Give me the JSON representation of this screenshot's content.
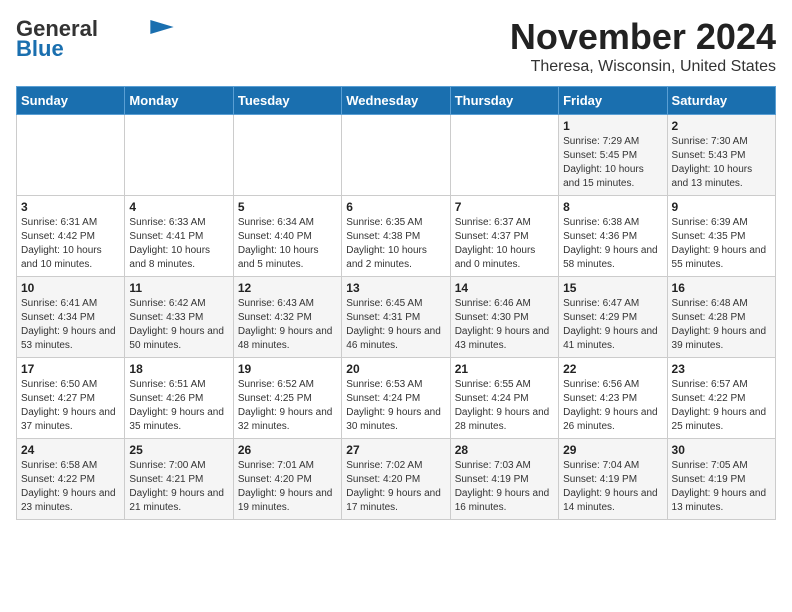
{
  "logo": {
    "line1": "General",
    "line2": "Blue"
  },
  "title": "November 2024",
  "subtitle": "Theresa, Wisconsin, United States",
  "weekdays": [
    "Sunday",
    "Monday",
    "Tuesday",
    "Wednesday",
    "Thursday",
    "Friday",
    "Saturday"
  ],
  "weeks": [
    [
      {
        "day": "",
        "info": ""
      },
      {
        "day": "",
        "info": ""
      },
      {
        "day": "",
        "info": ""
      },
      {
        "day": "",
        "info": ""
      },
      {
        "day": "",
        "info": ""
      },
      {
        "day": "1",
        "info": "Sunrise: 7:29 AM\nSunset: 5:45 PM\nDaylight: 10 hours and 15 minutes."
      },
      {
        "day": "2",
        "info": "Sunrise: 7:30 AM\nSunset: 5:43 PM\nDaylight: 10 hours and 13 minutes."
      }
    ],
    [
      {
        "day": "3",
        "info": "Sunrise: 6:31 AM\nSunset: 4:42 PM\nDaylight: 10 hours and 10 minutes."
      },
      {
        "day": "4",
        "info": "Sunrise: 6:33 AM\nSunset: 4:41 PM\nDaylight: 10 hours and 8 minutes."
      },
      {
        "day": "5",
        "info": "Sunrise: 6:34 AM\nSunset: 4:40 PM\nDaylight: 10 hours and 5 minutes."
      },
      {
        "day": "6",
        "info": "Sunrise: 6:35 AM\nSunset: 4:38 PM\nDaylight: 10 hours and 2 minutes."
      },
      {
        "day": "7",
        "info": "Sunrise: 6:37 AM\nSunset: 4:37 PM\nDaylight: 10 hours and 0 minutes."
      },
      {
        "day": "8",
        "info": "Sunrise: 6:38 AM\nSunset: 4:36 PM\nDaylight: 9 hours and 58 minutes."
      },
      {
        "day": "9",
        "info": "Sunrise: 6:39 AM\nSunset: 4:35 PM\nDaylight: 9 hours and 55 minutes."
      }
    ],
    [
      {
        "day": "10",
        "info": "Sunrise: 6:41 AM\nSunset: 4:34 PM\nDaylight: 9 hours and 53 minutes."
      },
      {
        "day": "11",
        "info": "Sunrise: 6:42 AM\nSunset: 4:33 PM\nDaylight: 9 hours and 50 minutes."
      },
      {
        "day": "12",
        "info": "Sunrise: 6:43 AM\nSunset: 4:32 PM\nDaylight: 9 hours and 48 minutes."
      },
      {
        "day": "13",
        "info": "Sunrise: 6:45 AM\nSunset: 4:31 PM\nDaylight: 9 hours and 46 minutes."
      },
      {
        "day": "14",
        "info": "Sunrise: 6:46 AM\nSunset: 4:30 PM\nDaylight: 9 hours and 43 minutes."
      },
      {
        "day": "15",
        "info": "Sunrise: 6:47 AM\nSunset: 4:29 PM\nDaylight: 9 hours and 41 minutes."
      },
      {
        "day": "16",
        "info": "Sunrise: 6:48 AM\nSunset: 4:28 PM\nDaylight: 9 hours and 39 minutes."
      }
    ],
    [
      {
        "day": "17",
        "info": "Sunrise: 6:50 AM\nSunset: 4:27 PM\nDaylight: 9 hours and 37 minutes."
      },
      {
        "day": "18",
        "info": "Sunrise: 6:51 AM\nSunset: 4:26 PM\nDaylight: 9 hours and 35 minutes."
      },
      {
        "day": "19",
        "info": "Sunrise: 6:52 AM\nSunset: 4:25 PM\nDaylight: 9 hours and 32 minutes."
      },
      {
        "day": "20",
        "info": "Sunrise: 6:53 AM\nSunset: 4:24 PM\nDaylight: 9 hours and 30 minutes."
      },
      {
        "day": "21",
        "info": "Sunrise: 6:55 AM\nSunset: 4:24 PM\nDaylight: 9 hours and 28 minutes."
      },
      {
        "day": "22",
        "info": "Sunrise: 6:56 AM\nSunset: 4:23 PM\nDaylight: 9 hours and 26 minutes."
      },
      {
        "day": "23",
        "info": "Sunrise: 6:57 AM\nSunset: 4:22 PM\nDaylight: 9 hours and 25 minutes."
      }
    ],
    [
      {
        "day": "24",
        "info": "Sunrise: 6:58 AM\nSunset: 4:22 PM\nDaylight: 9 hours and 23 minutes."
      },
      {
        "day": "25",
        "info": "Sunrise: 7:00 AM\nSunset: 4:21 PM\nDaylight: 9 hours and 21 minutes."
      },
      {
        "day": "26",
        "info": "Sunrise: 7:01 AM\nSunset: 4:20 PM\nDaylight: 9 hours and 19 minutes."
      },
      {
        "day": "27",
        "info": "Sunrise: 7:02 AM\nSunset: 4:20 PM\nDaylight: 9 hours and 17 minutes."
      },
      {
        "day": "28",
        "info": "Sunrise: 7:03 AM\nSunset: 4:19 PM\nDaylight: 9 hours and 16 minutes."
      },
      {
        "day": "29",
        "info": "Sunrise: 7:04 AM\nSunset: 4:19 PM\nDaylight: 9 hours and 14 minutes."
      },
      {
        "day": "30",
        "info": "Sunrise: 7:05 AM\nSunset: 4:19 PM\nDaylight: 9 hours and 13 minutes."
      }
    ]
  ]
}
